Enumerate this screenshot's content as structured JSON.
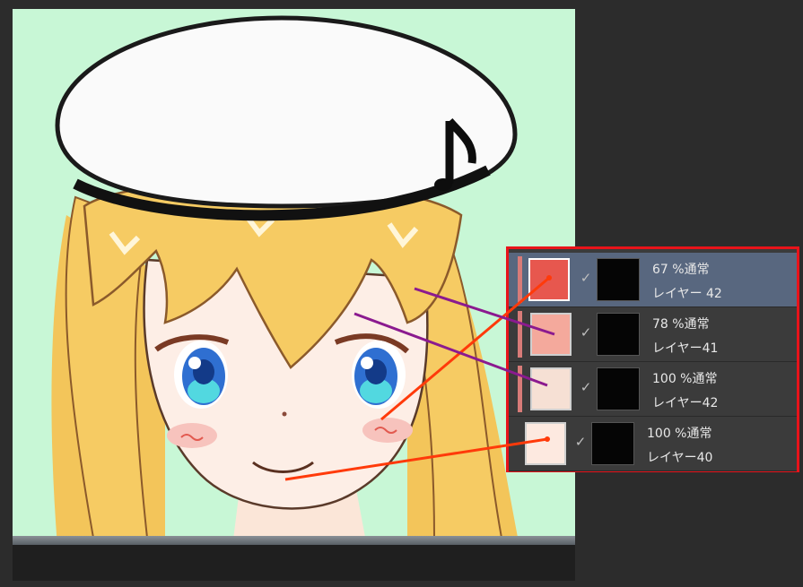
{
  "artwork": {
    "subject": "anime girl with white beret and blonde hair"
  },
  "layer_panel": {
    "highlight_color": "#e8131a",
    "layers": [
      {
        "opacity_mode": "67 %通常",
        "name": "レイヤー 42",
        "color": "#e7574e",
        "selected": true,
        "clipped": true
      },
      {
        "opacity_mode": "78 %通常",
        "name": "レイヤー41",
        "color": "#f4a99c",
        "selected": false,
        "clipped": true
      },
      {
        "opacity_mode": "100 %通常",
        "name": "レイヤー42",
        "color": "#f6e0d4",
        "selected": false,
        "clipped": true
      },
      {
        "opacity_mode": "100 %通常",
        "name": "レイヤー40",
        "color": "#fde9e0",
        "selected": false,
        "clipped": false
      }
    ]
  },
  "annotation_colors": {
    "red_line": "#ff3a0a",
    "purple_line": "#8b1a8f"
  }
}
